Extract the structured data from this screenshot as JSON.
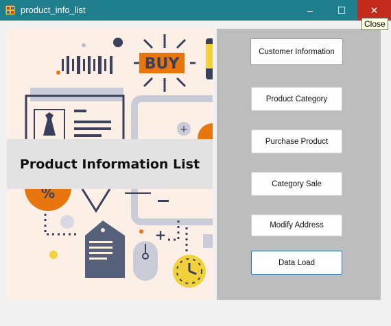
{
  "window": {
    "title": "product_info_list",
    "tooltip": "Close",
    "controls": {
      "minimize": "–",
      "maximize": "☐",
      "close": "✕"
    }
  },
  "banner": {
    "text": "Product Information List"
  },
  "illustration": {
    "buy_label": "BUY",
    "percent_label": "%"
  },
  "menu": {
    "customer_information": "Customer Information",
    "product_category": "Product Category",
    "purchase_product": "Purchase Product",
    "category_sale": "Category Sale",
    "modify_address": "Modify Address",
    "data_load": "Data Load"
  },
  "colors": {
    "titlebar": "#1f7f8c",
    "close": "#c42b1c",
    "illustration_bg": "#fcefe5",
    "accent_orange": "#e8760f",
    "navy": "#3a3f5c",
    "yellow": "#f2d23c"
  }
}
